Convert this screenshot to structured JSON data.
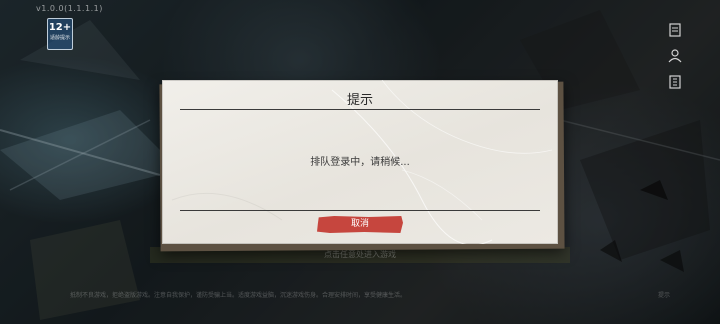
{
  "header": {
    "version": "v1.0.0(1.1.1.1)",
    "age_rating": "12+",
    "age_rating_sub": "适龄提示"
  },
  "right_toolbar": {
    "icons": [
      "announcement-icon",
      "account-icon",
      "menu-icon"
    ]
  },
  "dialog": {
    "title": "提示",
    "message": "排队登录中，请稍候...",
    "cancel_label": "取消"
  },
  "bottom": {
    "tap_hint": "点击任意处进入游戏",
    "footer_left": "抵制不良游戏，拒绝盗版游戏。注意自我保护，谨防受骗上当。适度游戏益脑，沉迷游戏伤身。合理安排时间，享受健康生活。",
    "footer_right": "提示"
  },
  "colors": {
    "dialog_paper": "#ece9e3",
    "dialog_frame": "#5d5142",
    "cancel_button": "#c6463e"
  }
}
